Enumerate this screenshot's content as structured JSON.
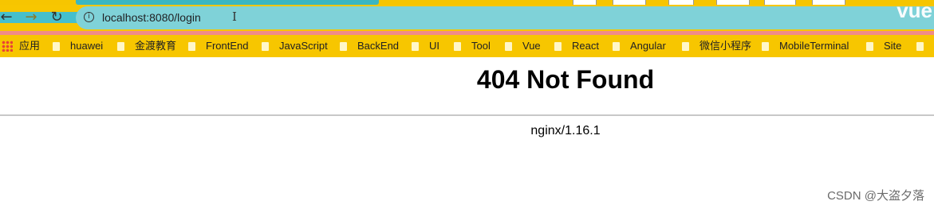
{
  "browser": {
    "address_bar": {
      "url": "localhost:8080/login"
    },
    "corner_logo": "vue",
    "bookmarks": [
      {
        "label": "应用",
        "type": "apps"
      },
      {
        "label": "huawei",
        "type": "folder"
      },
      {
        "label": "金渡教育",
        "type": "folder"
      },
      {
        "label": "FrontEnd",
        "type": "folder"
      },
      {
        "label": "JavaScript",
        "type": "folder"
      },
      {
        "label": "BackEnd",
        "type": "folder"
      },
      {
        "label": "UI",
        "type": "folder"
      },
      {
        "label": "Tool",
        "type": "folder"
      },
      {
        "label": "Vue",
        "type": "folder"
      },
      {
        "label": "React",
        "type": "folder"
      },
      {
        "label": "Angular",
        "type": "folder"
      },
      {
        "label": "微信小程序",
        "type": "folder"
      },
      {
        "label": "MobileTerminal",
        "type": "folder"
      },
      {
        "label": "Site",
        "type": "folder"
      }
    ]
  },
  "page": {
    "title": "404 Not Found",
    "server": "nginx/1.16.1"
  },
  "watermark": "CSDN @大盗夕落",
  "colors": {
    "toolbar": "#f7c600",
    "omnibox": "#7fd2d8",
    "accent_strip": "#f08b87"
  }
}
